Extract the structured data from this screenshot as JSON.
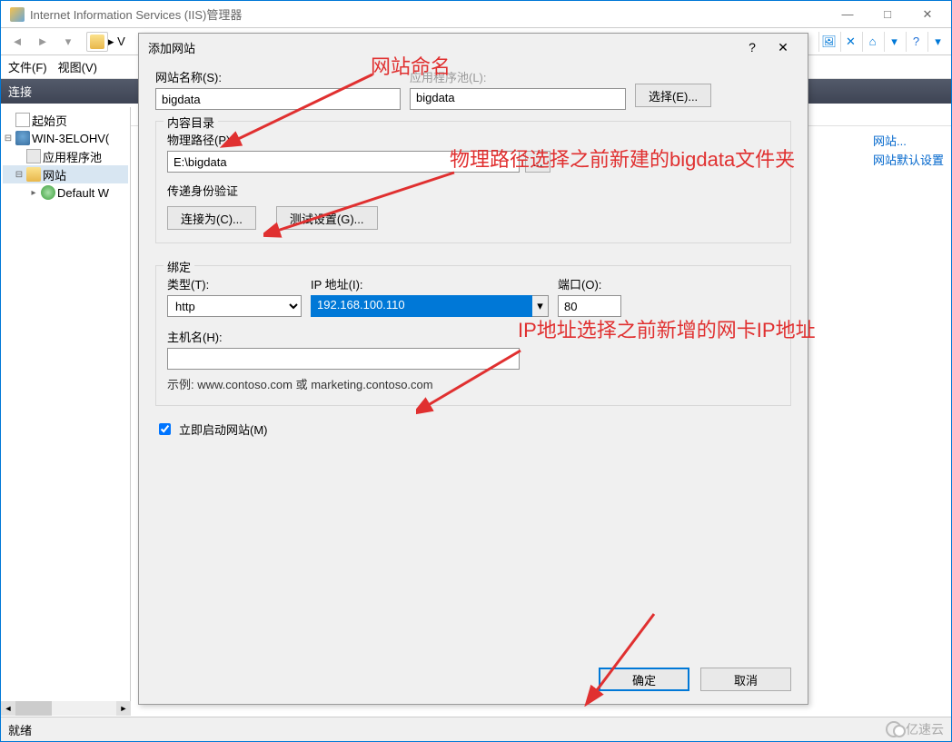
{
  "window": {
    "title": "Internet Information Services (IIS)管理器",
    "breadcrumb_text": "V"
  },
  "menu": {
    "file": "文件(F)",
    "view": "视图(V)"
  },
  "conn_panel": {
    "header": "连接",
    "tree": {
      "start": "起始页",
      "server": "WIN-3ELOHV(",
      "app_pools": "应用程序池",
      "sites": "网站",
      "default_site": "Default W"
    }
  },
  "right_links": {
    "link1": "网站...",
    "link2": "网站默认设置"
  },
  "dialog": {
    "title": "添加网站",
    "site_name_label": "网站名称(S):",
    "site_name_value": "bigdata",
    "app_pool_label": "应用程序池(L):",
    "app_pool_value": "bigdata",
    "select_btn": "选择(E)...",
    "content_group": "内容目录",
    "phys_path_label": "物理路径(P):",
    "phys_path_value": "E:\\bigdata",
    "browse_btn": "...",
    "auth_label": "传递身份验证",
    "connect_as_btn": "连接为(C)...",
    "test_btn": "测试设置(G)...",
    "binding_group": "绑定",
    "type_label": "类型(T):",
    "type_value": "http",
    "ip_label": "IP 地址(I):",
    "ip_value": "192.168.100.110",
    "port_label": "端口(O):",
    "port_value": "80",
    "host_label": "主机名(H):",
    "host_value": "",
    "example_text": "示例: www.contoso.com 或 marketing.contoso.com",
    "start_now_label": "立即启动网站(M)",
    "ok_btn": "确定",
    "cancel_btn": "取消"
  },
  "annotations": {
    "a1": "网站命名",
    "a2": "物理路径选择之前新建的bigdata文件夹",
    "a3": "IP地址选择之前新增的网卡IP地址"
  },
  "status": {
    "ready": "就绪",
    "brand": "亿速云"
  }
}
